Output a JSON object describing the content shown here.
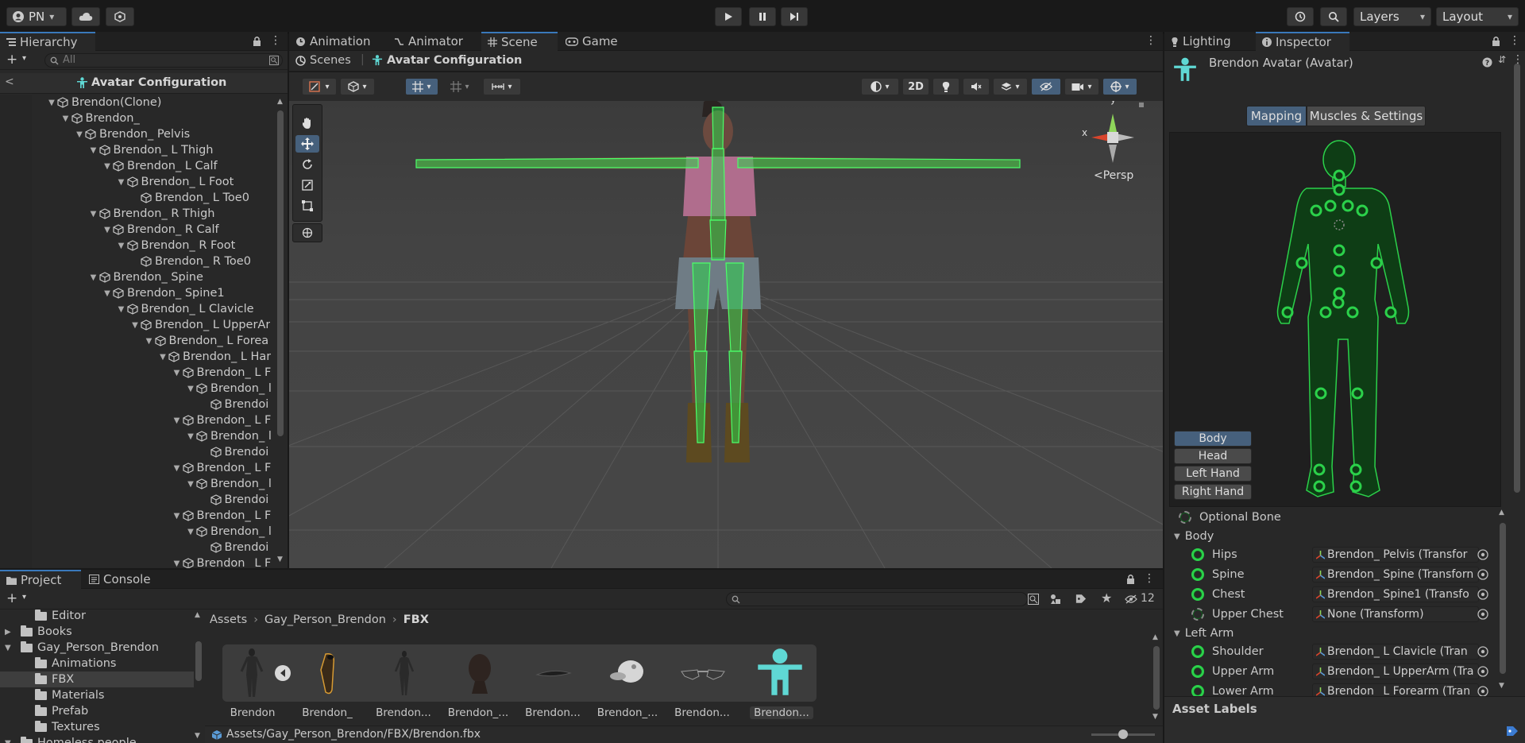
{
  "toolbar": {
    "account": "PN",
    "layers": "Layers",
    "layout": "Layout"
  },
  "hierarchy": {
    "tab": "Hierarchy",
    "search_placeholder": "All",
    "header": "Avatar Configuration",
    "rows": [
      {
        "label": "Brendon(Clone)",
        "depth": 0,
        "expanded": true
      },
      {
        "label": "Brendon_",
        "depth": 1,
        "expanded": true
      },
      {
        "label": "Brendon_ Pelvis",
        "depth": 2,
        "expanded": true
      },
      {
        "label": "Brendon_ L Thigh",
        "depth": 3,
        "expanded": true
      },
      {
        "label": "Brendon_ L Calf",
        "depth": 4,
        "expanded": true
      },
      {
        "label": "Brendon_ L Foot",
        "depth": 5,
        "expanded": true
      },
      {
        "label": "Brendon_ L Toe0",
        "depth": 6,
        "expanded": false
      },
      {
        "label": "Brendon_ R Thigh",
        "depth": 3,
        "expanded": true
      },
      {
        "label": "Brendon_ R Calf",
        "depth": 4,
        "expanded": true
      },
      {
        "label": "Brendon_ R Foot",
        "depth": 5,
        "expanded": true
      },
      {
        "label": "Brendon_ R Toe0",
        "depth": 6,
        "expanded": false
      },
      {
        "label": "Brendon_ Spine",
        "depth": 3,
        "expanded": true
      },
      {
        "label": "Brendon_ Spine1",
        "depth": 4,
        "expanded": true
      },
      {
        "label": "Brendon_ L Clavicle",
        "depth": 5,
        "expanded": true
      },
      {
        "label": "Brendon_ L UpperAr",
        "depth": 6,
        "expanded": true
      },
      {
        "label": "Brendon_ L Forea",
        "depth": 7,
        "expanded": true
      },
      {
        "label": "Brendon_ L Har",
        "depth": 8,
        "expanded": true
      },
      {
        "label": "Brendon_ L F",
        "depth": 9,
        "expanded": true
      },
      {
        "label": "Brendon_ l",
        "depth": 10,
        "expanded": true
      },
      {
        "label": "Brendoi",
        "depth": 11,
        "expanded": false
      },
      {
        "label": "Brendon_ L F",
        "depth": 9,
        "expanded": true
      },
      {
        "label": "Brendon_ l",
        "depth": 10,
        "expanded": true
      },
      {
        "label": "Brendoi",
        "depth": 11,
        "expanded": false
      },
      {
        "label": "Brendon_ L F",
        "depth": 9,
        "expanded": true
      },
      {
        "label": "Brendon_ l",
        "depth": 10,
        "expanded": true
      },
      {
        "label": "Brendoi",
        "depth": 11,
        "expanded": false
      },
      {
        "label": "Brendon_ L F",
        "depth": 9,
        "expanded": true
      },
      {
        "label": "Brendon_ l",
        "depth": 10,
        "expanded": true
      },
      {
        "label": "Brendoi",
        "depth": 11,
        "expanded": false
      },
      {
        "label": "Brendon_ L F",
        "depth": 9,
        "expanded": true
      }
    ]
  },
  "center_tabs": [
    "Animation",
    "Animator",
    "Scene",
    "Game"
  ],
  "scene": {
    "breadcrumb_root": "Scenes",
    "breadcrumb_current": "Avatar Configuration",
    "btn_2d": "2D",
    "persp": "Persp",
    "gizmo_x": "x",
    "gizmo_y": "y"
  },
  "right_tabs": [
    "Lighting",
    "Inspector"
  ],
  "inspector": {
    "title": "Brendon Avatar (Avatar)",
    "segment_mapping": "Mapping",
    "segment_muscles": "Muscles & Settings",
    "body_parts": [
      "Body",
      "Head",
      "Left Hand",
      "Right Hand"
    ],
    "optional_bone": "Optional Bone",
    "section_body": "Body",
    "body_rows": [
      {
        "label": "Hips",
        "value": "Brendon_ Pelvis (Transfor",
        "state": "solid"
      },
      {
        "label": "Spine",
        "value": "Brendon_ Spine (Transforn",
        "state": "solid"
      },
      {
        "label": "Chest",
        "value": "Brendon_ Spine1 (Transfo",
        "state": "solid"
      },
      {
        "label": "Upper Chest",
        "value": "None (Transform)",
        "state": "dashed"
      }
    ],
    "section_left_arm": "Left Arm",
    "arm_rows": [
      {
        "label": "Shoulder",
        "value": "Brendon_ L Clavicle (Tran",
        "state": "solid"
      },
      {
        "label": "Upper Arm",
        "value": "Brendon_ L UpperArm (Tra",
        "state": "solid"
      },
      {
        "label": "Lower Arm",
        "value": "Brendon_ L Forearm (Tran",
        "state": "solid"
      }
    ],
    "asset_labels": "Asset Labels"
  },
  "bottom_tabs": [
    "Project",
    "Console"
  ],
  "project": {
    "visible_count": "12",
    "tree": [
      {
        "label": "Editor",
        "depth": 1,
        "arrow": ""
      },
      {
        "label": "Books",
        "depth": 0,
        "arrow": "▶"
      },
      {
        "label": "Gay_Person_Brendon",
        "depth": 0,
        "arrow": "▼"
      },
      {
        "label": "Animations",
        "depth": 1,
        "arrow": ""
      },
      {
        "label": "FBX",
        "depth": 1,
        "arrow": "",
        "selected": true
      },
      {
        "label": "Materials",
        "depth": 1,
        "arrow": ""
      },
      {
        "label": "Prefab",
        "depth": 1,
        "arrow": ""
      },
      {
        "label": "Textures",
        "depth": 1,
        "arrow": ""
      },
      {
        "label": "Homeless people",
        "depth": 0,
        "arrow": "▼"
      }
    ],
    "path": [
      "Assets",
      "Gay_Person_Brendon",
      "FBX"
    ],
    "assets": [
      "Brendon",
      "Brendon_",
      "Brendon...",
      "Brendon_...",
      "Brendon...",
      "Brendon_...",
      "Brendon...",
      "Brendon..."
    ],
    "status_path": "Assets/Gay_Person_Brendon/FBX/Brendon.fbx"
  },
  "colors": {
    "accent": "#3a79bb",
    "bone_green": "#2bd14a",
    "avatar_cyan": "#5fd8d4"
  }
}
